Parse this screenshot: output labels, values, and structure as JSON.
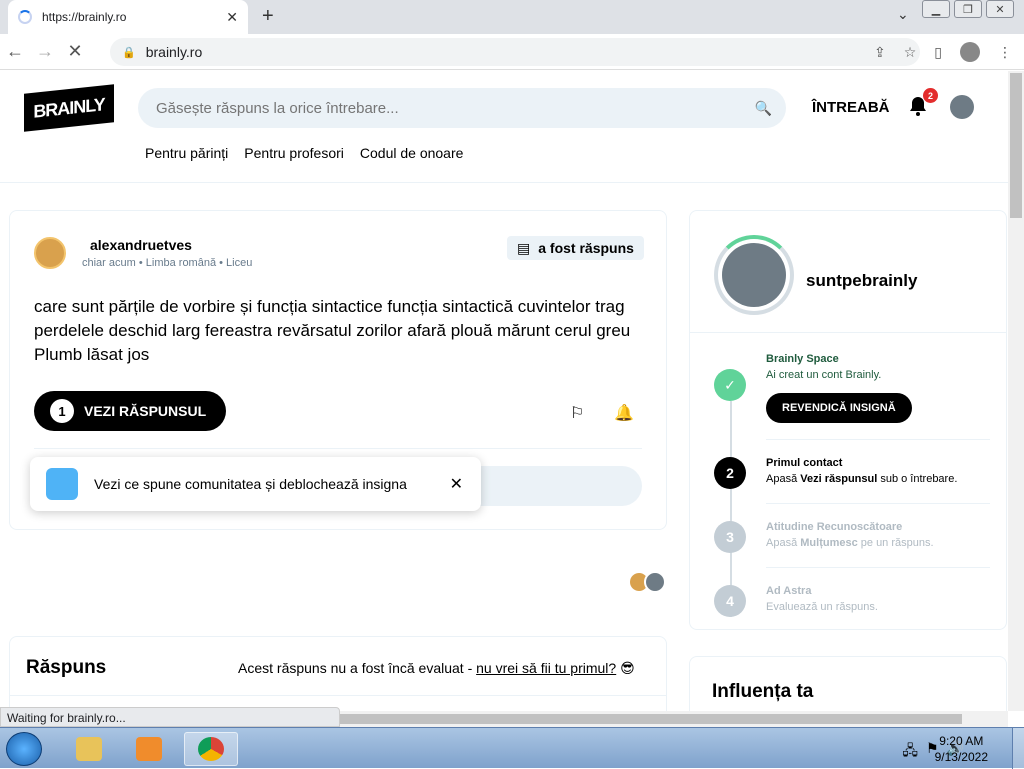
{
  "browser": {
    "tab_title": "https://brainly.ro",
    "url": "brainly.ro",
    "status_text": "Waiting for brainly.ro..."
  },
  "header": {
    "logo_text": "BRAINLY",
    "search_placeholder": "Găsește răspuns la orice întrebare...",
    "ask_label": "ÎNTREABĂ",
    "notification_count": "2",
    "nav": [
      "Pentru părinți",
      "Pentru profesori",
      "Codul de onoare"
    ]
  },
  "question": {
    "username": "alexandruetves",
    "meta": "chiar acum • Limba română • Liceu",
    "answered_label": "a fost răspuns",
    "text": "care sunt părțile de vorbire și funcția sintactice funcția sintactică cuvintelor trag perdelele deschid larg fereastra revărsatul zorilor afară plouă mărunt cerul greu Plumb lăsat jos",
    "see_answer_count": "1",
    "see_answer_label": "VEZI RĂSPUNSUL"
  },
  "toast": {
    "text": "Vezi ce spune comunitatea și deblochează insigna"
  },
  "answer": {
    "title": "Răspuns",
    "note_prefix": "Acest răspuns nu a fost încă evaluat - ",
    "note_link": "nu vrei să fii tu primul?",
    "note_emoji": "😎"
  },
  "sidebar": {
    "username": "suntpebrainly",
    "steps": [
      {
        "num": "✓",
        "title": "Brainly Space",
        "desc": "Ai creat un cont Brainly.",
        "button": "REVENDICĂ INSIGNĂ"
      },
      {
        "num": "2",
        "title": "Primul contact",
        "desc_pre": "Apasă ",
        "desc_bold": "Vezi răspunsul",
        "desc_post": " sub o întrebare."
      },
      {
        "num": "3",
        "title": "Atitudine Recunoscătoare",
        "desc_pre": "Apasă ",
        "desc_bold": "Mulțumesc",
        "desc_post": " pe un răspuns."
      },
      {
        "num": "4",
        "title": "Ad Astra",
        "desc": "Evaluează un răspuns."
      }
    ],
    "influence_title": "Influența ta"
  },
  "taskbar": {
    "time": "9:20 AM",
    "date": "9/13/2022"
  },
  "colors": {
    "accent_green": "#60d399",
    "brand_black": "#000000",
    "panel_gray": "#ebf2f7",
    "badge_red": "#e32d2d"
  }
}
